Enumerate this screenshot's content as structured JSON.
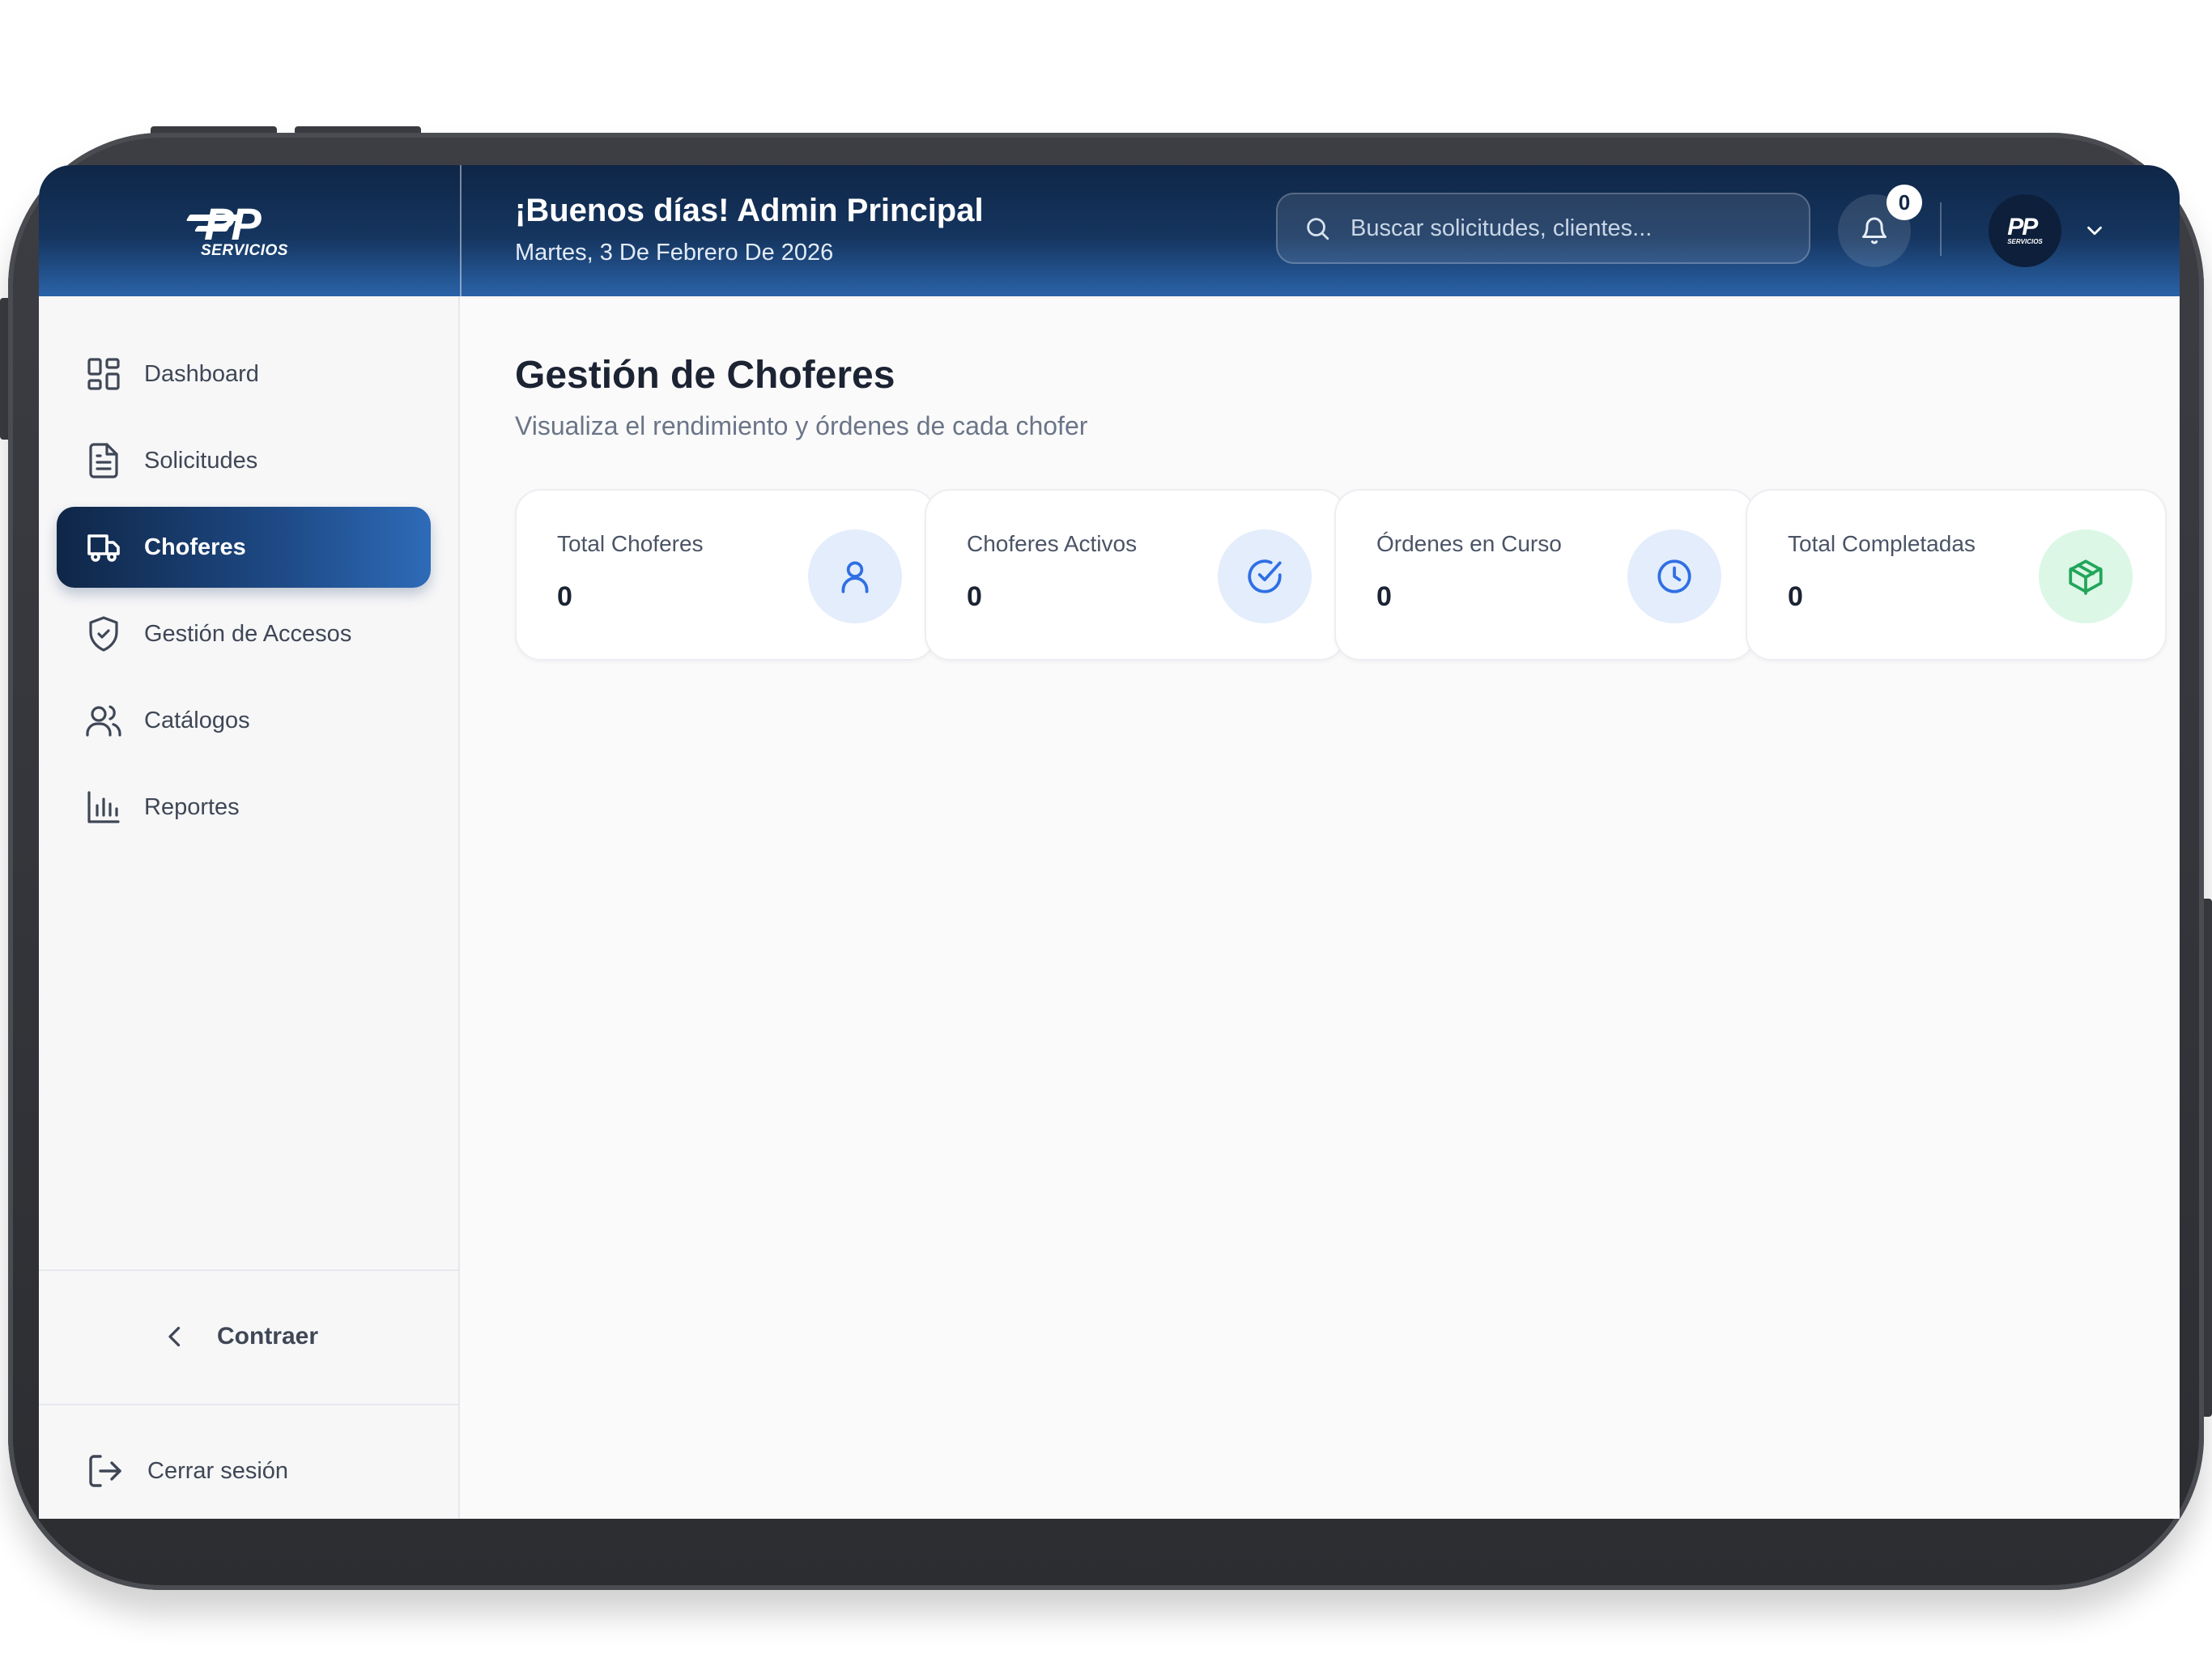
{
  "header": {
    "logo": {
      "brand": "PP",
      "subtitle": "SERVICIOS"
    },
    "greeting": "¡Buenos días! Admin Principal",
    "date": "Martes, 3 De Febrero De 2026",
    "search": {
      "placeholder": "Buscar solicitudes, clientes..."
    },
    "notifications": {
      "count": "0",
      "icon": "bell-icon"
    },
    "profile": {
      "avatar_text": "PP",
      "avatar_sub": "SERVICIOS",
      "icon": "chevron-down-icon"
    }
  },
  "sidebar": {
    "items": [
      {
        "label": "Dashboard",
        "icon": "dashboard-icon",
        "active": false
      },
      {
        "label": "Solicitudes",
        "icon": "document-icon",
        "active": false
      },
      {
        "label": "Choferes",
        "icon": "truck-icon",
        "active": true
      },
      {
        "label": "Gestión de Accesos",
        "icon": "shield-icon",
        "active": false
      },
      {
        "label": "Catálogos",
        "icon": "users-icon",
        "active": false
      },
      {
        "label": "Reportes",
        "icon": "bar-chart-icon",
        "active": false
      }
    ],
    "collapse_label": "Contraer",
    "logout_label": "Cerrar sesión"
  },
  "main": {
    "title": "Gestión de Choferes",
    "subtitle": "Visualiza el rendimiento y órdenes de cada chofer",
    "cards": [
      {
        "label": "Total Choferes",
        "value": "0",
        "icon": "user-icon",
        "bg": "#e3edfc",
        "fg": "#2f6fe4"
      },
      {
        "label": "Choferes Activos",
        "value": "0",
        "icon": "check-circle-icon",
        "bg": "#e3edfc",
        "fg": "#2f6fe4"
      },
      {
        "label": "Órdenes en Curso",
        "value": "0",
        "icon": "clock-icon",
        "bg": "#e3edfc",
        "fg": "#2f6fe4"
      },
      {
        "label": "Total Completadas",
        "value": "0",
        "icon": "box-icon",
        "bg": "#dcf7e6",
        "fg": "#22a55a"
      }
    ]
  },
  "colors": {
    "header_dark": "#0f2647",
    "header_light": "#2a63a8",
    "accent_blue": "#2f6fe4",
    "accent_green": "#22a55a"
  }
}
